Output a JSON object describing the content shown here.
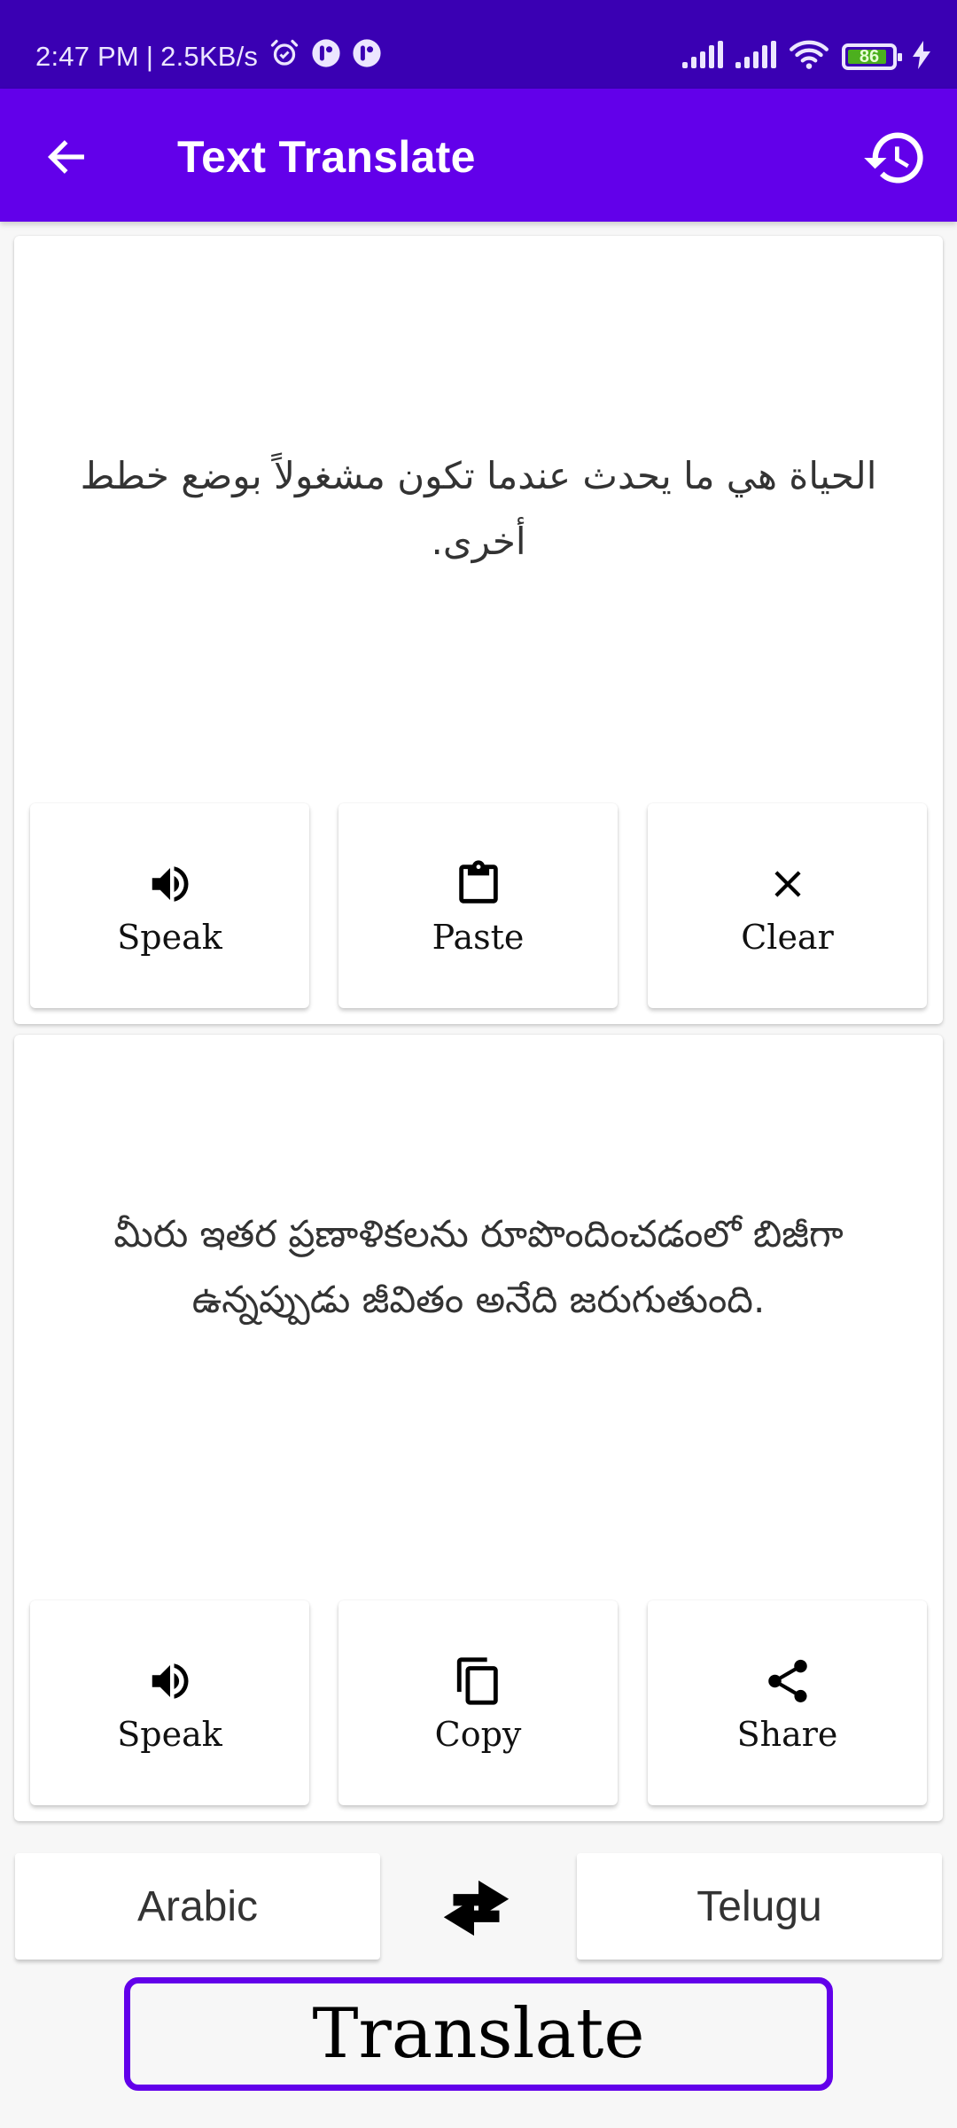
{
  "status_bar": {
    "time": "2:47 PM",
    "separator": "|",
    "net_speed": "2.5KB/s",
    "battery_level": "86",
    "icons": [
      "alarm-icon",
      "app-notification-icon",
      "app-notification-icon",
      "signal-icon",
      "signal-icon",
      "wifi-icon",
      "battery-icon",
      "charging-icon"
    ]
  },
  "app_bar": {
    "title": "Text Translate",
    "back_icon": "arrow-back-icon",
    "history_icon": "history-icon"
  },
  "input_card": {
    "text": "الحياة هي ما يحدث عندما تكون مشغولاً بوضع خطط أخرى.",
    "buttons": [
      {
        "label": "Speak",
        "icon": "speaker-icon"
      },
      {
        "label": "Paste",
        "icon": "clipboard-icon"
      },
      {
        "label": "Clear",
        "icon": "close-icon"
      }
    ]
  },
  "output_card": {
    "text": "మీరు ఇతర ప్రణాళికలను రూపొందించడంలో బిజీగా ఉన్నప్పుడు జీవితం అనేది జరుగుతుంది.",
    "buttons": [
      {
        "label": "Speak",
        "icon": "speaker-icon"
      },
      {
        "label": "Copy",
        "icon": "copy-icon"
      },
      {
        "label": "Share",
        "icon": "share-icon"
      }
    ]
  },
  "languages": {
    "source": "Arabic",
    "target": "Telugu",
    "swap_icon": "swap-icon"
  },
  "translate_button": {
    "label": "Translate"
  },
  "colors": {
    "status_bar": "#3a00b3",
    "primary": "#6200ea",
    "background": "#f7f7f7",
    "battery_fill": "#4caf1e"
  }
}
